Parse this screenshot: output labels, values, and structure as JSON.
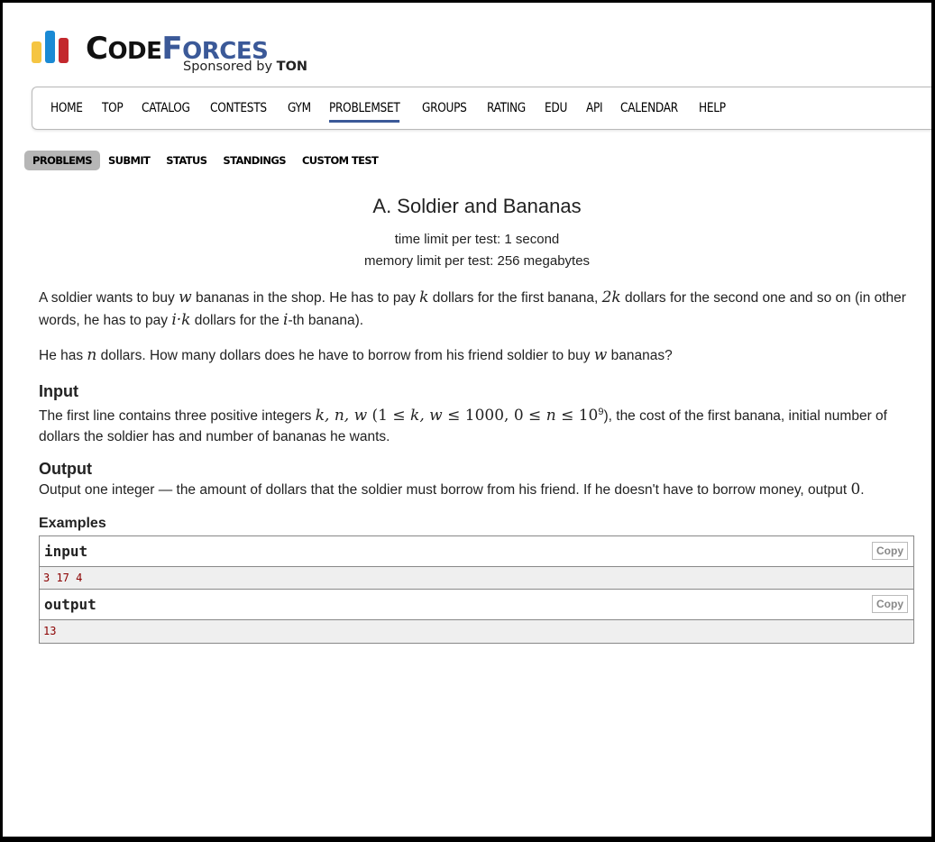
{
  "logo": {
    "word_code_big": "C",
    "word_code_rest": "ODE",
    "word_forces_big": "F",
    "word_forces_rest": "ORCES",
    "sponsor_prefix": "Sponsored by ",
    "sponsor_brand": "TON",
    "colors": {
      "yellow": "#f5c542",
      "blue": "#1a8ad4",
      "red": "#c3282d",
      "code": "#111111",
      "forces": "#3b5998"
    }
  },
  "nav": {
    "items": [
      "HOME",
      "TOP",
      "CATALOG",
      "CONTESTS",
      "GYM",
      "PROBLEMSET",
      "GROUPS",
      "RATING",
      "EDU",
      "API",
      "CALENDAR",
      "HELP"
    ],
    "active": "PROBLEMSET"
  },
  "subnav": {
    "items": [
      "PROBLEMS",
      "SUBMIT",
      "STATUS",
      "STANDINGS",
      "CUSTOM TEST"
    ],
    "active": "PROBLEMS"
  },
  "problem": {
    "title": "A. Soldier and Bananas",
    "time_limit": "time limit per test: 1 second",
    "memory_limit": "memory limit per test: 256 megabytes",
    "statement": {
      "p1_a": "A soldier wants to buy ",
      "p1_w": "w",
      "p1_b": " bananas in the shop. He has to pay ",
      "p1_k": "k",
      "p1_c": " dollars for the first banana, ",
      "p1_2k": "2k",
      "p1_d": " dollars for the second one and so on (in other words, he has to pay ",
      "p1_ik": "i·k",
      "p1_e": " dollars for the ",
      "p1_i": "i",
      "p1_f": "-th banana).",
      "p2_a": "He has ",
      "p2_n": "n",
      "p2_b": " dollars. How many dollars does he have to borrow from his friend soldier to buy ",
      "p2_w": "w",
      "p2_c": " bananas?"
    },
    "input": {
      "title": "Input",
      "text_a": "The first line contains three positive integers ",
      "vars": "k, n, w",
      "constraint_a": " (1 ≤ ",
      "constraint_kw": "k, w",
      "constraint_b": " ≤ 1000, 0 ≤ ",
      "constraint_n": "n",
      "constraint_c": " ≤ 10",
      "constraint_exp": "9",
      "text_b": "), the cost of the first banana, initial number of dollars the soldier has and number of bananas he wants."
    },
    "output": {
      "title": "Output",
      "text_a": "Output one integer — the amount of dollars that the soldier must borrow from his friend. If he doesn't have to borrow money, output ",
      "zero": "0",
      "text_b": "."
    },
    "examples": {
      "title": "Examples",
      "input_label": "input",
      "input_value": "3 17 4",
      "output_label": "output",
      "output_value": "13",
      "copy_label": "Copy"
    }
  }
}
